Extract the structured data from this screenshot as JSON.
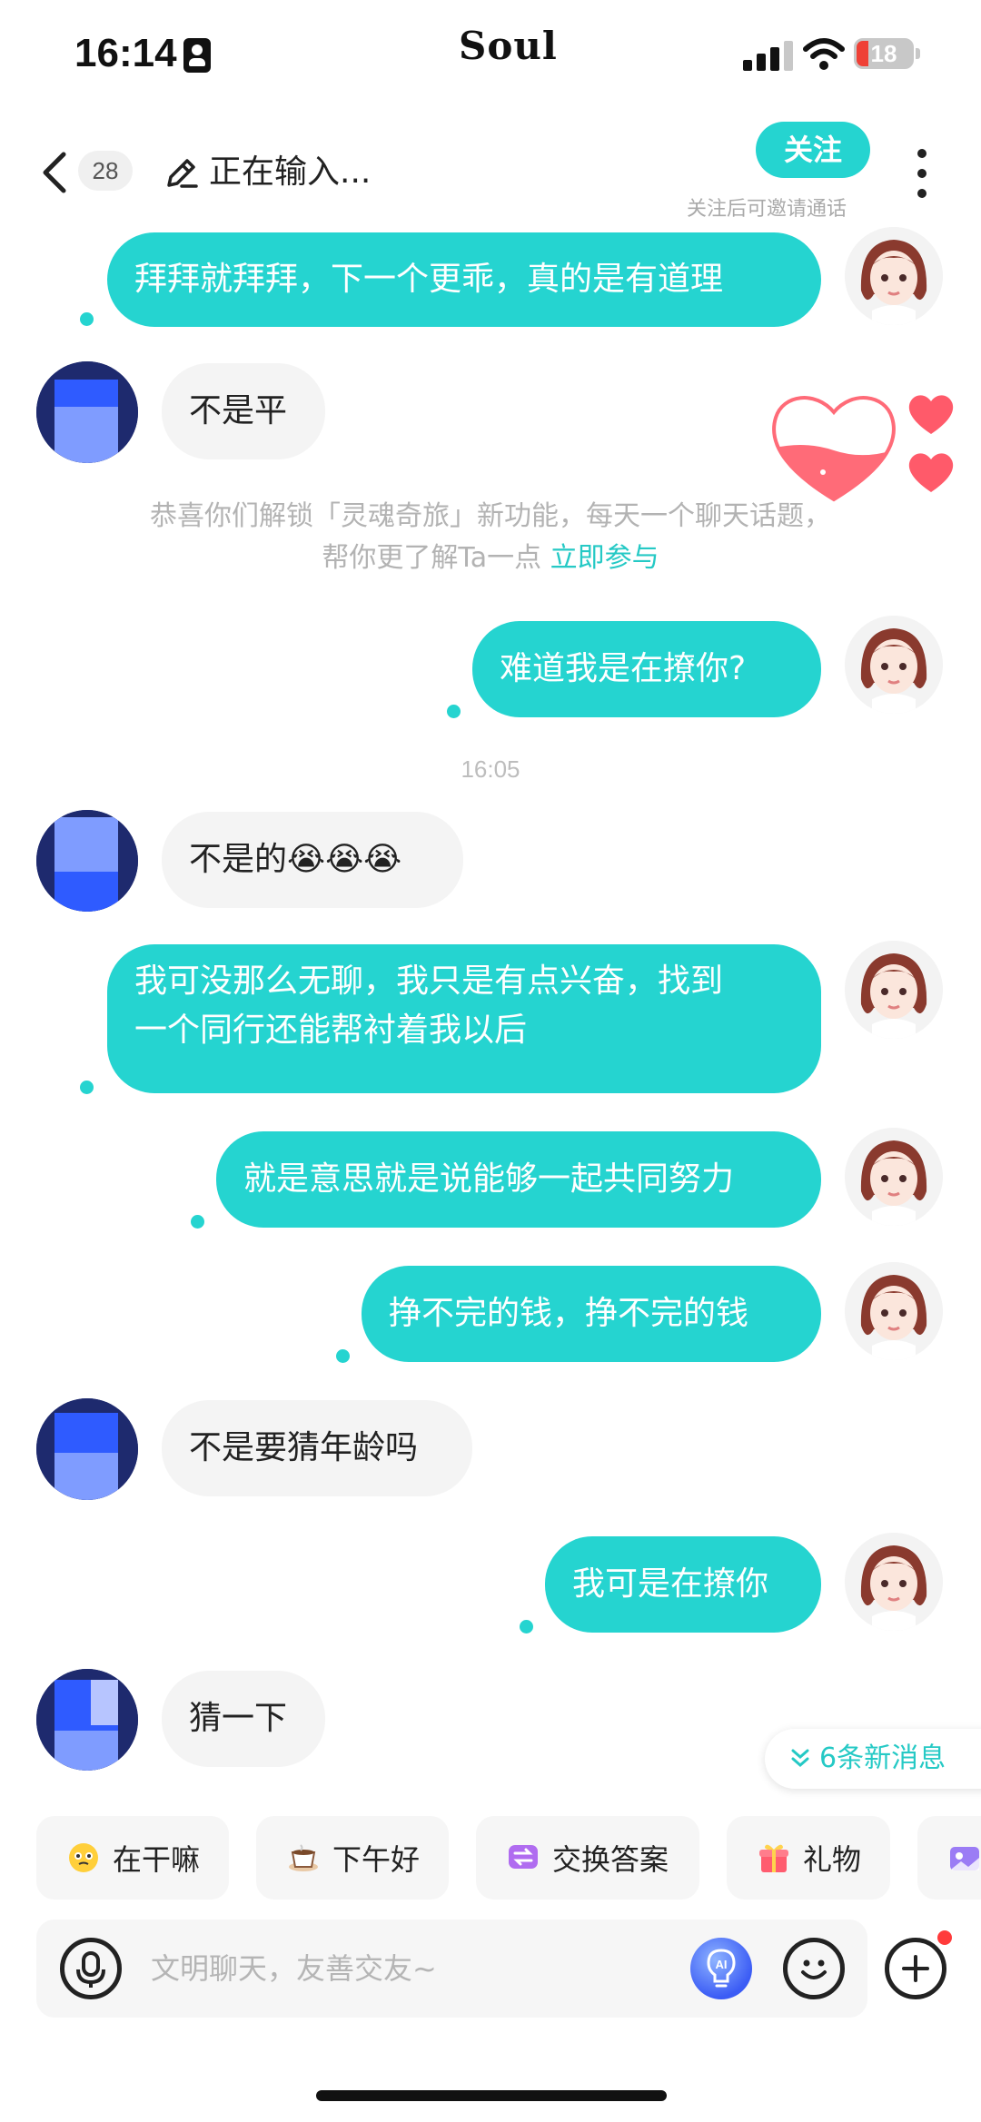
{
  "status_bar": {
    "time": "16:14",
    "battery": "18"
  },
  "app_name": "Soul",
  "nav": {
    "unread_count": "28",
    "title": "正在输入...",
    "follow_label": "关注",
    "follow_hint": "关注后可邀请通话"
  },
  "messages": [
    {
      "from": "me",
      "text": "拜拜就拜拜，下一个更乖，真的是有道理"
    },
    {
      "from": "other",
      "text": "不是平"
    },
    {
      "from": "me",
      "text": "难道我是在撩你?"
    },
    {
      "from": "other",
      "text": "不是的😭😭😭"
    },
    {
      "from": "me",
      "text": "我可没那么无聊，我只是有点兴奋，找到\n一个同行还能帮衬着我以后"
    },
    {
      "from": "me",
      "text": "就是意思就是说能够一起共同努力"
    },
    {
      "from": "me",
      "text": "挣不完的钱，挣不完的钱"
    },
    {
      "from": "other",
      "text": "不是要猜年龄吗"
    },
    {
      "from": "me",
      "text": "我可是在撩你"
    },
    {
      "from": "other",
      "text": "猜一下"
    }
  ],
  "system_notice": {
    "line1": "恭喜你们解锁「灵魂奇旅」新功能，每天一个聊天话题，",
    "line2": "帮你更了解Ta一点",
    "link": "立即参与"
  },
  "timestamp": "16:05",
  "new_messages": "6条新消息",
  "quick_chips": [
    {
      "label": "在干嘛",
      "icon": "face-emoji-icon"
    },
    {
      "label": "下午好",
      "icon": "coffee-icon"
    },
    {
      "label": "交换答案",
      "icon": "swap-icon"
    },
    {
      "label": "礼物",
      "icon": "gift-icon"
    }
  ],
  "input": {
    "placeholder": "文明聊天，友善交友~"
  },
  "colors": {
    "accent": "#25d4d0",
    "bubble_other": "#f4f4f4",
    "heart": "#ff5a6a",
    "badge": "#ff3b3b"
  }
}
